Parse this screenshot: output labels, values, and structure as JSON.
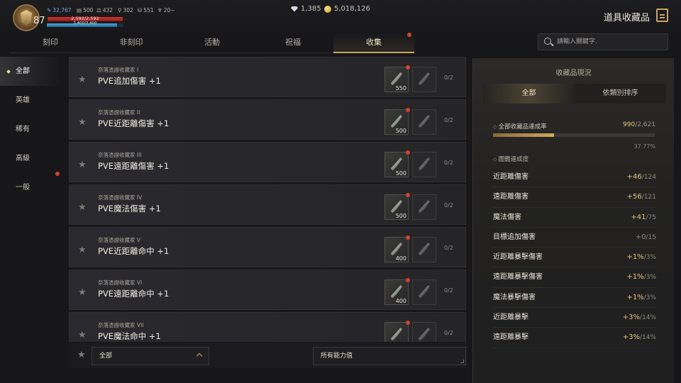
{
  "player": {
    "level": "87",
    "res1": "32,767",
    "res2": "500",
    "res3": "432",
    "res4": "302",
    "res5": "551",
    "res6": "20~",
    "hp_text": "2,592/2,592",
    "hp_fraction": 1.0,
    "mp_text": "3,400/3,400",
    "mp_fraction": 0.92
  },
  "currency": {
    "gems": "1,385",
    "gold": "5,018,126"
  },
  "header": {
    "title": "道具收藏品"
  },
  "tabs": [
    {
      "label": "刻印"
    },
    {
      "label": "非刻印"
    },
    {
      "label": "活動"
    },
    {
      "label": "祝福"
    },
    {
      "label": "收集"
    }
  ],
  "search": {
    "placeholder": "請輸入關鍵字."
  },
  "sidebar": {
    "items": [
      {
        "label": "全部"
      },
      {
        "label": "英雄"
      },
      {
        "label": "稀有"
      },
      {
        "label": "高級"
      },
      {
        "label": "一般"
      }
    ]
  },
  "collections": [
    {
      "sub": "奈落憑證收藏家 I",
      "name": "PVE追加傷害 +1",
      "count": "550",
      "progress": "0/2"
    },
    {
      "sub": "奈落憑證收藏家 II",
      "name": "PVE近距離傷害 +1",
      "count": "500",
      "progress": "0/2"
    },
    {
      "sub": "奈落憑證收藏家 III",
      "name": "PVE遠距離傷害 +1",
      "count": "500",
      "progress": "0/2"
    },
    {
      "sub": "奈落憑證收藏家 IV",
      "name": "PVE魔法傷害 +1",
      "count": "500",
      "progress": "0/2"
    },
    {
      "sub": "奈落憑證收藏家 V",
      "name": "PVE近距離命中 +1",
      "count": "400",
      "progress": "0/2"
    },
    {
      "sub": "奈落憑證收藏家 VI",
      "name": "PVE遠距離命中 +1",
      "count": "400",
      "progress": "0/2"
    },
    {
      "sub": "奈落憑證收藏家 VII",
      "name": "PVE魔法命中 +1",
      "count": "",
      "progress": "0/2"
    }
  ],
  "filters": {
    "grade": "全部",
    "stat": "所有能力值"
  },
  "panel": {
    "title": "收藏品現況",
    "tab_all": "全部",
    "tab_type": "依類別排序",
    "overall_label": "全部收藏品達成率",
    "overall_current": "990",
    "overall_total": "/2,621",
    "overall_fraction": 0.3777,
    "overall_percent": "37.77%",
    "sub_head": "圖鑑達成度",
    "stats": [
      {
        "name": "近距離傷害",
        "value": "+46",
        "total": "/124"
      },
      {
        "name": "遠距離傷害",
        "value": "+56",
        "total": "/121"
      },
      {
        "name": "魔法傷害",
        "value": "+41",
        "total": "/75"
      },
      {
        "name": "目標追加傷害",
        "value": "+0",
        "total": "/15"
      },
      {
        "name": "近距離暴擊傷害",
        "value": "+1%",
        "total": "/3%"
      },
      {
        "name": "遠距離暴擊傷害",
        "value": "+1%",
        "total": "/3%"
      },
      {
        "name": "魔法暴擊傷害",
        "value": "+1%",
        "total": "/3%"
      },
      {
        "name": "近距離暴擊",
        "value": "+3%",
        "total": "/14%"
      },
      {
        "name": "遠距離暴擊",
        "value": "+3%",
        "total": "/14%"
      }
    ]
  },
  "colors": {
    "accent": "#c9a467",
    "highlight_value": "#e6c47b",
    "notification": "#d0442d"
  }
}
